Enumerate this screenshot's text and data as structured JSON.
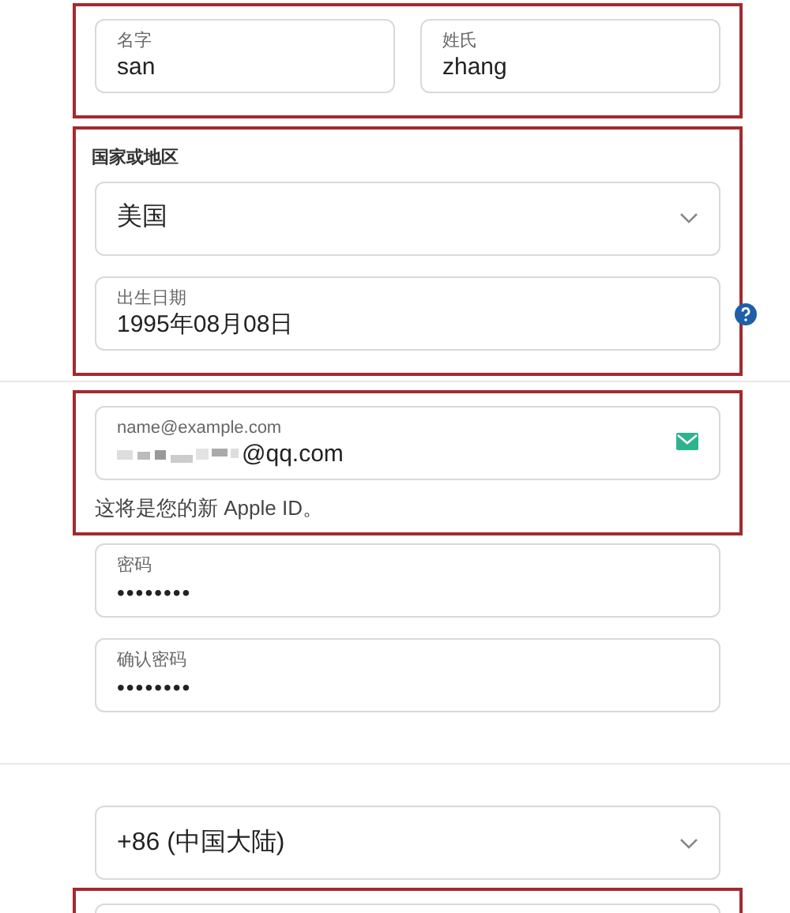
{
  "blocks": [
    {
      "kind": "group",
      "highlighted": true,
      "row": [
        {
          "kind": "text",
          "label": "名字",
          "value": "san"
        },
        {
          "kind": "text",
          "label": "姓氏",
          "value": "zhang"
        }
      ]
    },
    {
      "kind": "group",
      "highlighted": true,
      "heading": "国家或地区",
      "fields": [
        {
          "kind": "select",
          "value": "美国"
        },
        {
          "kind": "text",
          "label": "出生日期",
          "value": "1995年08月08日",
          "help": true
        }
      ]
    },
    {
      "kind": "divider"
    },
    {
      "kind": "group",
      "highlighted": true,
      "fields": [
        {
          "kind": "email",
          "label": "name@example.com",
          "value": "@qq.com",
          "masked_prefix": true,
          "status_icon": true
        }
      ],
      "caption": "这将是您的新 Apple ID。"
    },
    {
      "kind": "group",
      "highlighted": false,
      "fields": [
        {
          "kind": "password",
          "label": "密码",
          "value": "••••••••"
        },
        {
          "kind": "password",
          "label": "确认密码",
          "value": "••••••••"
        }
      ]
    },
    {
      "kind": "divider"
    },
    {
      "kind": "group",
      "highlighted": false,
      "fields": [
        {
          "kind": "select",
          "value": "+86 (中国大陆)"
        }
      ]
    },
    {
      "kind": "group",
      "highlighted": true,
      "fields": [
        {
          "kind": "blank"
        }
      ]
    }
  ]
}
